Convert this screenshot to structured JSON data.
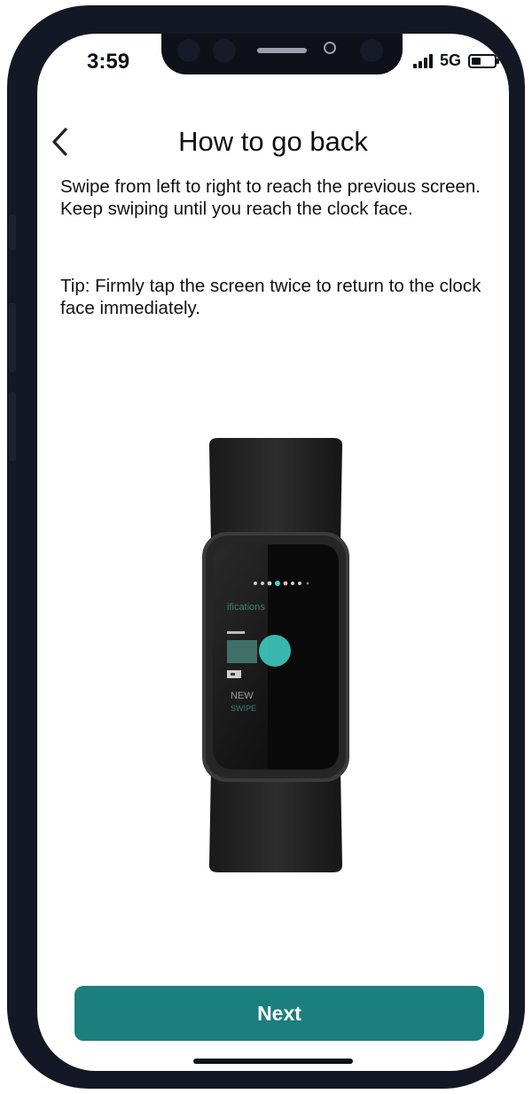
{
  "status_bar": {
    "time": "3:59",
    "network": "5G",
    "signal_bars": 4,
    "battery_level": 0.4
  },
  "header": {
    "title": "How to go back",
    "back_icon": "chevron-left-icon"
  },
  "content": {
    "instruction": "Swipe from left to right to reach the previous screen. Keep swiping until you reach the clock face.",
    "tip": "Tip: Firmly tap the screen twice to return to the clock face immediately."
  },
  "device_screen": {
    "notifications_label": "ifications",
    "new_label": "NEW",
    "swipe_label": "SWIPE"
  },
  "footer": {
    "next_label": "Next"
  },
  "colors": {
    "accent": "#1b7f7d",
    "touch_indicator": "#3ec6bd",
    "frame": "#141824"
  }
}
